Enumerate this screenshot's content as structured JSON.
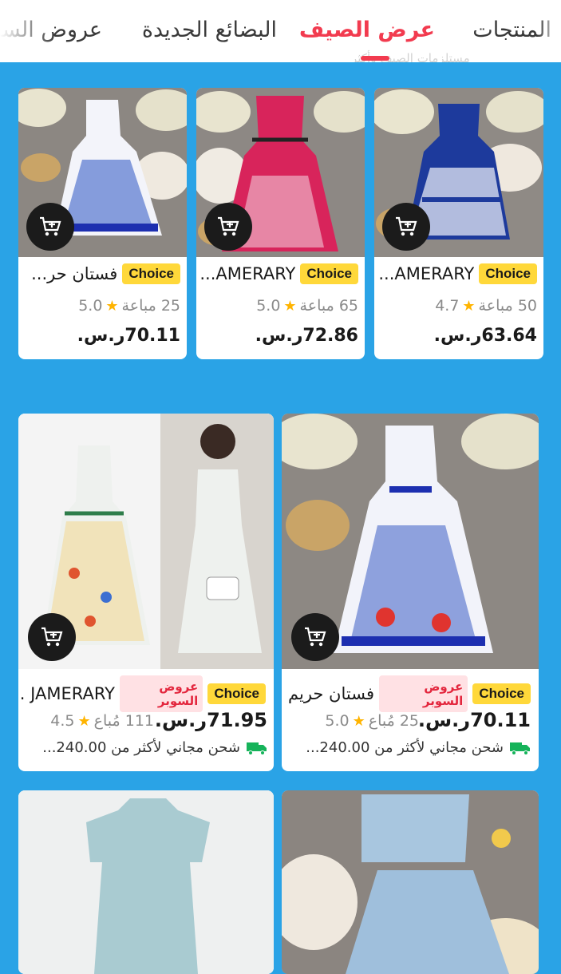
{
  "tabs": [
    {
      "label": "المنتجات"
    },
    {
      "label": "عرض الصيف",
      "active": true
    },
    {
      "label": "البضائع الجديدة"
    },
    {
      "label": "عروض السوبر"
    }
  ],
  "tabs_ghost_text": "مستلزمات الصيف وأكثر",
  "colors": {
    "background": "#2aa3e6",
    "accent": "#f23b4f",
    "choice": "#ffd83a",
    "super_bg": "#ffe1e4",
    "super_text": "#e3263d",
    "star": "#ffb400",
    "truck": "#16b35a"
  },
  "badges": {
    "choice": "Choice",
    "super": "عروض السوبر"
  },
  "products_small": [
    {
      "title": "AMERARY...",
      "sold": "50 مباعة",
      "rating": "4.7",
      "price": "63.64ر.س."
    },
    {
      "title": "AMERARY...",
      "sold": "65 مباعة",
      "rating": "5.0",
      "price": "72.86ر.س."
    },
    {
      "title": "فستان حر...",
      "sold": "25 مباعة",
      "rating": "5.0",
      "price": "70.11ر.س."
    }
  ],
  "products_large": [
    {
      "title": "فستان حريم...",
      "price": "70.11ر.س.",
      "sold": "25 مُباع",
      "rating": "5.0",
      "shipping": "شحن مجاني لأكثر من 240.00..."
    },
    {
      "title": "JAMERARY ...",
      "price": "71.95ر.س.",
      "sold": "111 مُباع",
      "rating": "4.5",
      "shipping": "شحن مجاني لأكثر من 240.00..."
    }
  ],
  "icons": {
    "cart": "add-to-cart-icon",
    "star": "star-icon",
    "truck": "free-shipping-truck-icon"
  }
}
